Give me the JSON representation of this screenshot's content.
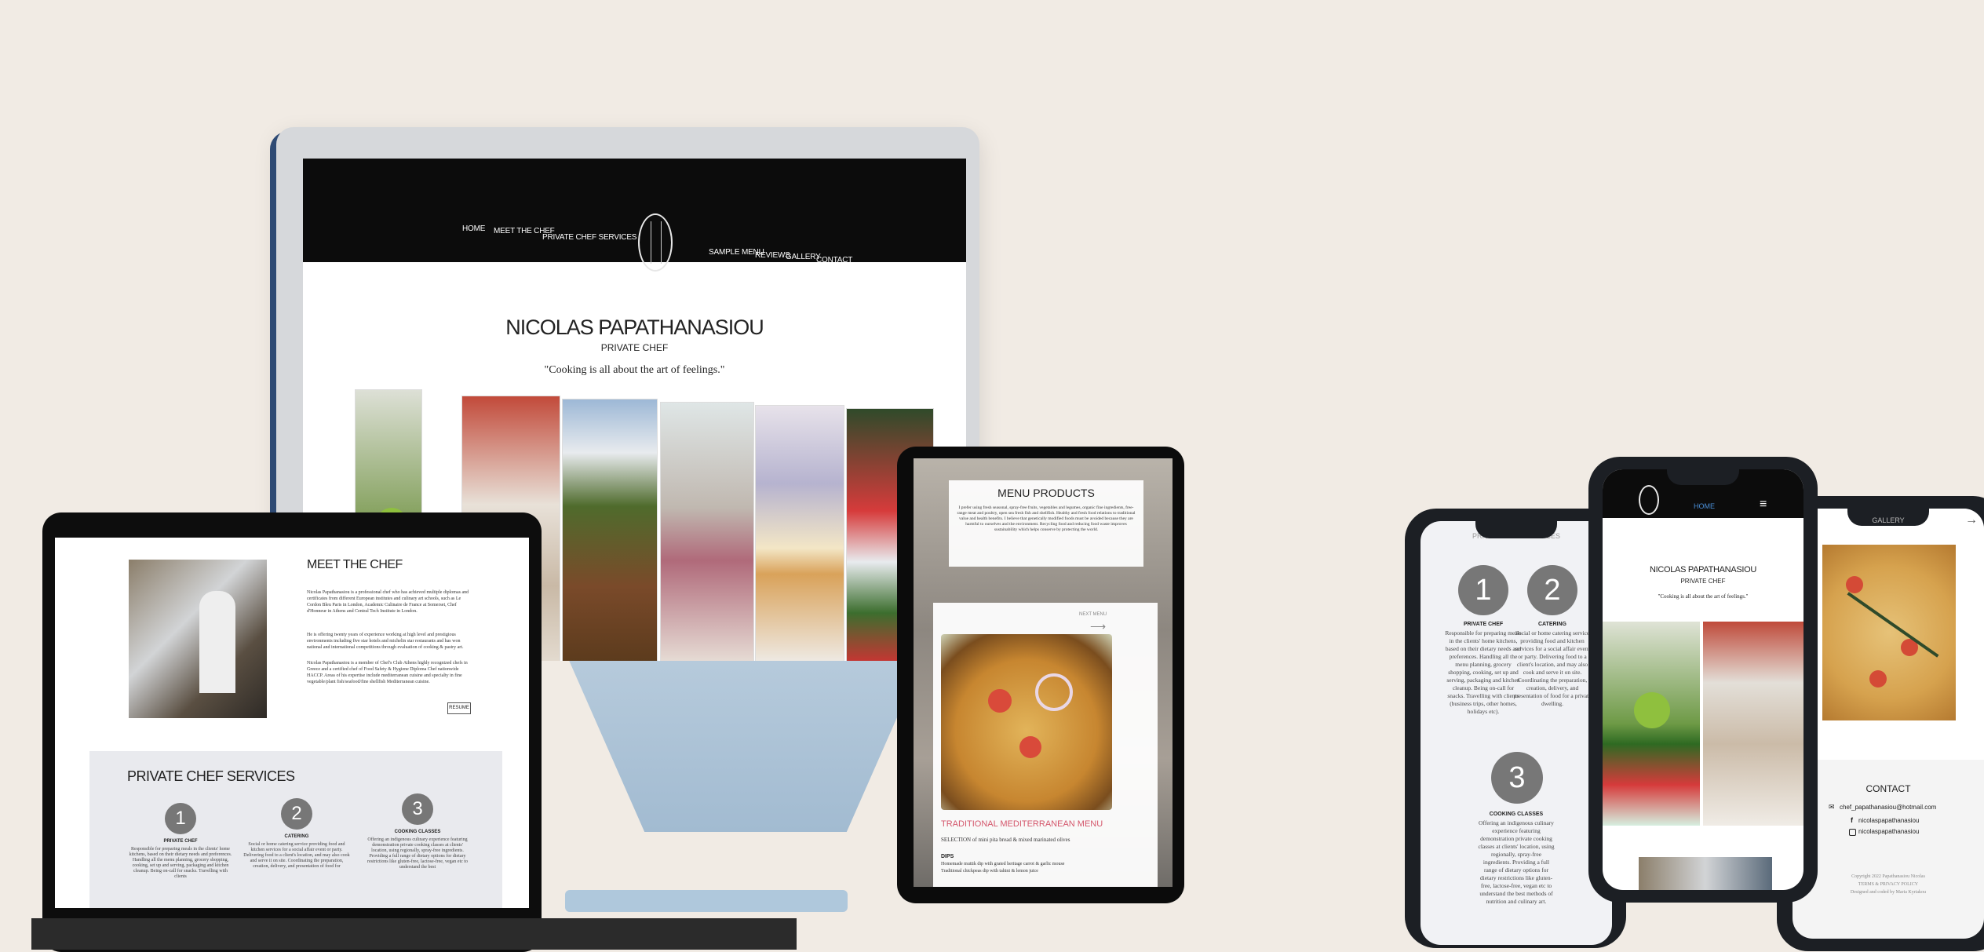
{
  "site": {
    "name": "NICOLAS PAPATHANASIOU",
    "subtitle": "PRIVATE CHEF",
    "quote": "\"Cooking is all about the art of feelings.\"",
    "nav_left": [
      "HOME",
      "MEET THE CHEF",
      "PRIVATE CHEF SERVICES"
    ],
    "nav_right": [
      "SAMPLE MENU",
      "REVIEWS",
      "GALLERY",
      "CONTACT"
    ]
  },
  "laptop": {
    "meet_title": "MEET THE CHEF",
    "meet_text": "Nicolas Papathanasiou is a professional chef who has achieved multiple diplomas and certificates from different European institutes and culinary art schools, such as Le Cordon Bleu Paris in London, Academic Culinaire de France at Somerset, Chef d'Honneur in Athens and Central Tech Institute in London.",
    "meet_text2": "He is offering twenty years of experience working at high level and prestigious environments including five star hotels and michelin star restaurants and has won national and international competitions through evaluation of cooking & pastry art.",
    "meet_text3": "Nicolas Papathanasiou is a member of Chef's Club Athens highly recognized chefs in Greece and a certified chef of Food Safety & Hygiene Diploma Chef nationwide HACCP. Areas of his expertise include mediterranean cuisine and specialty in fine vegetable/plant fish/seafood/fine shellfish Mediterranean cuisine.",
    "resume_label": "RESUME",
    "services_title": "PRIVATE CHEF SERVICES",
    "services": [
      {
        "num": "1",
        "title": "PRIVATE CHEF",
        "text": "Responsible for preparing meals in the clients' home kitchens, based on their dietary needs and preferences. Handling all the menu planning, grocery shopping, cooking, set up and serving, packaging and kitchen cleanup. Being on-call for snacks. Travelling with clients"
      },
      {
        "num": "2",
        "title": "CATERING",
        "text": "Social or home catering service providing food and kitchen services for a social affair event or party. Delivering food to a client's location, and may also cook and serve it on site. Coordinating the preparation, creation, delivery, and presentation of food for"
      },
      {
        "num": "3",
        "title": "COOKING CLASSES",
        "text": "Offering an indigenous culinary experience featuring demonstration private cooking classes at clients' location, using regionally, spray-free ingredients. Providing a full range of dietary options for dietary restrictions like gluten-free, lactose-free, vegan etc to understand the best"
      }
    ]
  },
  "tablet": {
    "menu_title": "MENU PRODUCTS",
    "menu_text": "I prefer using fresh seasonal, spray-free fruits, vegetables and legumes, organic fine ingredients, free-range meat and poultry, open sea fresh fish and shellfish. Healthy and fresh food relations to traditional value and health benefits. I believe that genetically modified foods must be avoided because they are harmful to ourselves and the environment. Recycling food and reducing food waste improves sustainability which helps conserve by protecting the world.",
    "next_label": "NEXT MENU",
    "section_title": "TRADITIONAL MEDITERRANEAN MENU",
    "selection": "SELECTION of mini pita bread & mixed marinated olives",
    "dips_title": "DIPS",
    "dips": [
      "Homemade muttik dip with grated heritage carrot & garlic mouse",
      "Traditional chickpeas dip with tahini & lemon juice"
    ]
  },
  "phone_left": {
    "header": "PRIVATE CHEF SERVICES",
    "items": [
      {
        "num": "1",
        "title": "PRIVATE CHEF",
        "text": "Responsible for preparing meals in the clients' home kitchens, based on their dietary needs and preferences. Handling all the menu planning, grocery shopping, cooking, set up and serving, packaging and kitchen cleanup. Being on-call for snacks. Travelling with clients (business trips, other homes, holidays etc)."
      },
      {
        "num": "2",
        "title": "CATERING",
        "text": "Social or home catering service providing food and kitchen services for a social affair event or party. Delivering food to a client's location, and may also cook and serve it on site. Coordinating the preparation, creation, delivery, and presentation of food for a private dwelling."
      },
      {
        "num": "3",
        "title": "COOKING CLASSES",
        "text": "Offering an indigenous culinary experience featuring demonstration private cooking classes at clients' location, using regionally, spray-free ingredients. Providing a full range of dietary options for dietary restrictions like gluten-free, lactose-free, vegan etc to understand the best methods of nutrition and culinary art."
      }
    ]
  },
  "phone_center": {
    "home_label": "HOME",
    "name": "NICOLAS PAPATHANASIOU",
    "subtitle": "PRIVATE CHEF",
    "quote": "\"Cooking is all about the art of feelings.\""
  },
  "phone_right": {
    "header": "GALLERY",
    "contact_title": "CONTACT",
    "email": "chef_papathanasiou@hotmail.com",
    "facebook": "nicolaspapathanasiou",
    "instagram": "nicolaspapathanasiou",
    "copyright": "Copyright 2022 Papathanasiou Nicolas",
    "terms": "TERMS & PRIVACY POLICY",
    "credit": "Designed and coded by Maria Kyriakou"
  },
  "colors": {
    "background": "#f1ebe4",
    "accent_red": "#d4566b",
    "accent_blue": "#4a8fd8",
    "nav_black": "#0c0c0c",
    "circle_gray": "#777777"
  }
}
